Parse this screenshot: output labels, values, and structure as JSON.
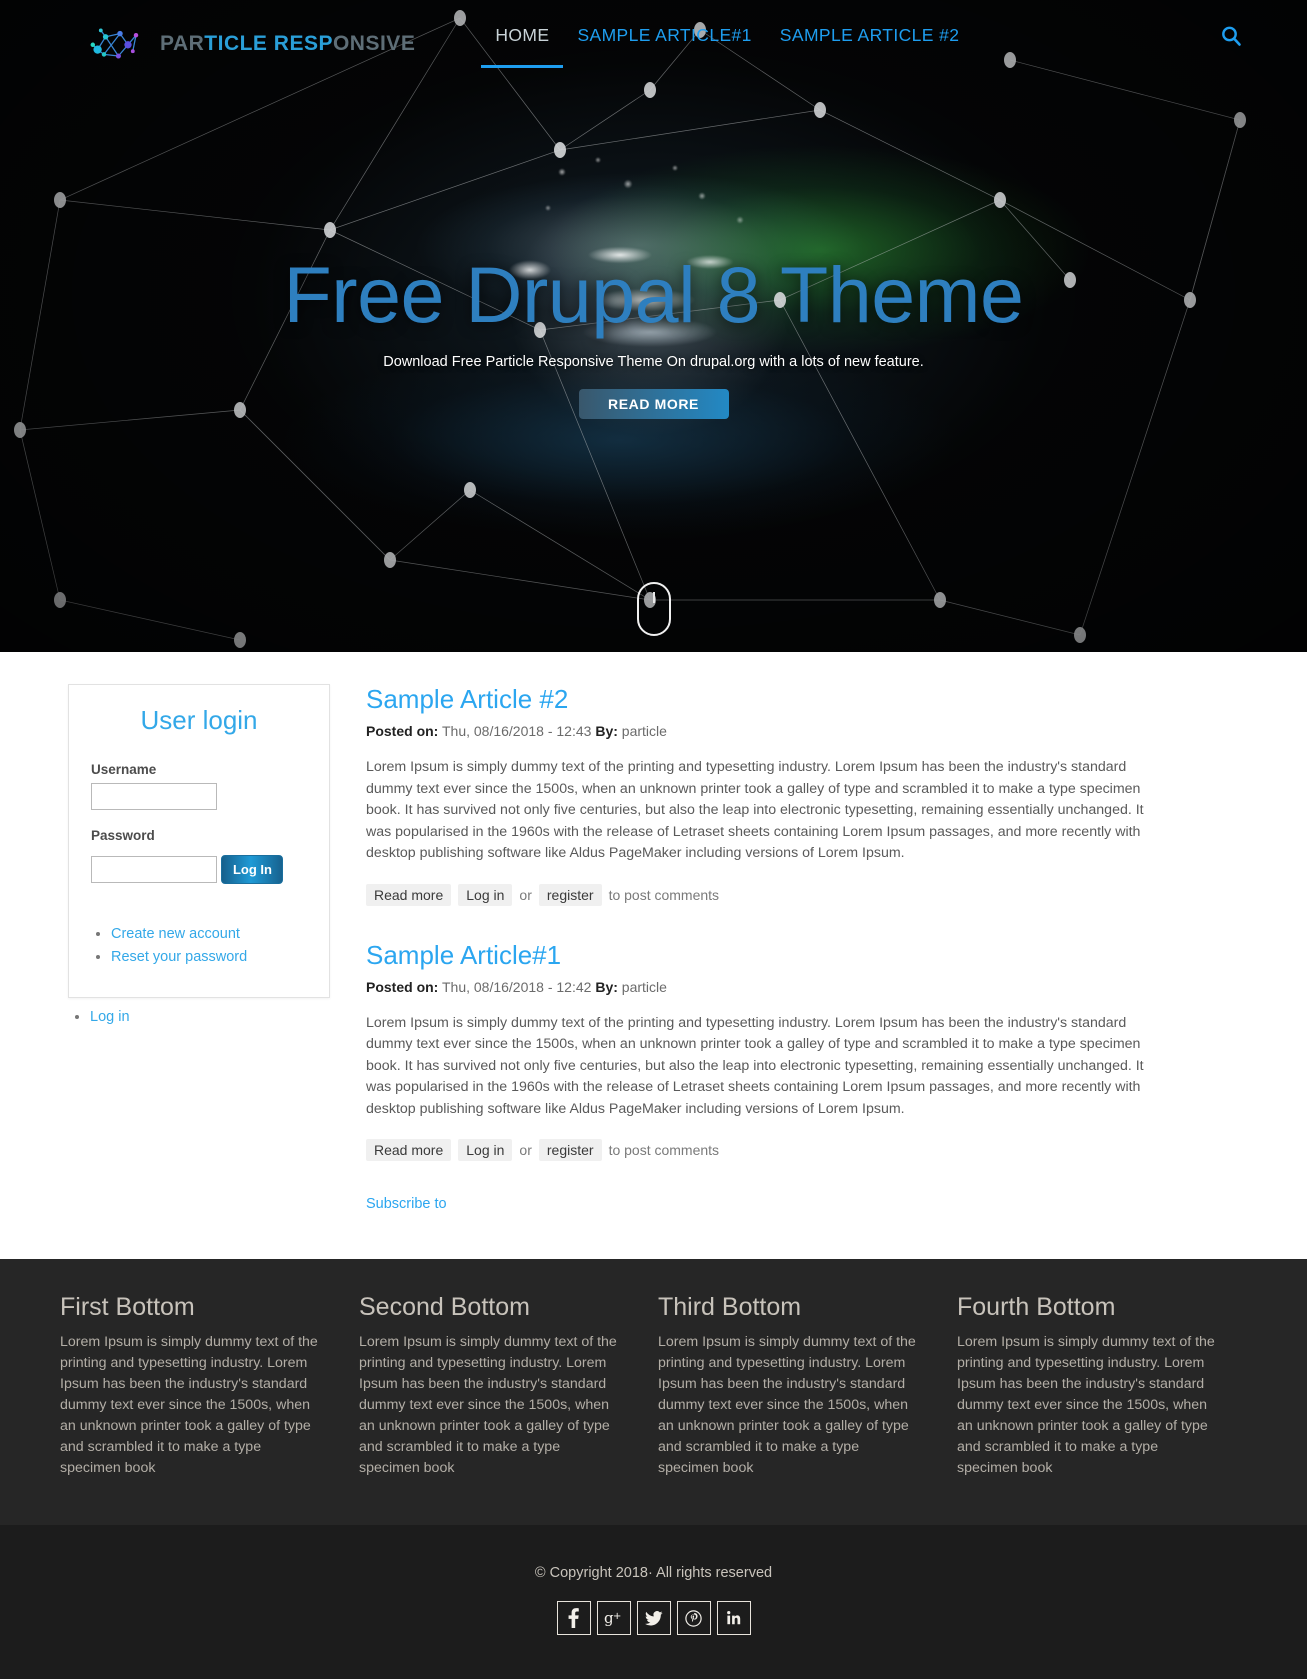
{
  "header": {
    "brand_dim_a": "PAR",
    "brand_lit": "TICLE RESP",
    "brand_dim_b": "ONSIVE",
    "brand_full": "PARTICLE RESPONSIVE",
    "nav": [
      {
        "label": "HOME",
        "active": true
      },
      {
        "label": "SAMPLE ARTICLE#1",
        "active": false
      },
      {
        "label": "SAMPLE ARTICLE #2",
        "active": false
      }
    ],
    "search_icon": "search-icon",
    "accent_color": "#1e9ef0"
  },
  "hero": {
    "title": "Free Drupal 8 Theme",
    "subtitle": "Download Free Particle Responsive Theme On drupal.org with a lots of new feature.",
    "cta_label": "READ MORE",
    "scroll_icon": "mouse-scroll-icon",
    "title_color": "#2e7fbf"
  },
  "sidebar": {
    "login": {
      "title": "User login",
      "username_label": "Username",
      "username_value": "",
      "password_label": "Password",
      "password_value": "",
      "submit_label": "Log In",
      "links": [
        "Create new account",
        "Reset your password"
      ]
    },
    "below_links": [
      "Log in"
    ]
  },
  "articles": [
    {
      "title": "Sample Article #2",
      "posted_label": "Posted on:",
      "posted_value": "Thu, 08/16/2018 - 12:43",
      "by_label": "By:",
      "by_value": "particle",
      "body": "Lorem Ipsum is simply dummy text of the printing and typesetting industry. Lorem Ipsum has been the industry's standard dummy text ever since the 1500s, when an unknown printer took a galley of type and scrambled it to make a type specimen book. It has survived not only five centuries, but also the leap into electronic typesetting, remaining essentially unchanged. It was popularised in the 1960s with the release of Letraset sheets containing Lorem Ipsum passages, and more recently with desktop publishing software like Aldus PageMaker including versions of Lorem Ipsum.",
      "read_more": "Read more",
      "login_link": "Log in",
      "or_text": "or",
      "register_link": "register",
      "post_comments_text": "to post comments"
    },
    {
      "title": "Sample Article#1",
      "posted_label": "Posted on:",
      "posted_value": "Thu, 08/16/2018 - 12:42",
      "by_label": "By:",
      "by_value": "particle",
      "body": "Lorem Ipsum is simply dummy text of the printing and typesetting industry. Lorem Ipsum has been the industry's standard dummy text ever since the 1500s, when an unknown printer took a galley of type and scrambled it to make a type specimen book. It has survived not only five centuries, but also the leap into electronic typesetting, remaining essentially unchanged. It was popularised in the 1960s with the release of Letraset sheets containing Lorem Ipsum passages, and more recently with desktop publishing software like Aldus PageMaker including versions of Lorem Ipsum.",
      "read_more": "Read more",
      "login_link": "Log in",
      "or_text": "or",
      "register_link": "register",
      "post_comments_text": "to post comments"
    }
  ],
  "subscribe_label": "Subscribe to",
  "footer": {
    "columns": [
      {
        "title": "First Bottom",
        "text": "Lorem Ipsum is simply dummy text of the printing and typesetting industry. Lorem Ipsum has been the industry's standard dummy text ever since the 1500s, when an unknown printer took a galley of type and scrambled it to make a type specimen book"
      },
      {
        "title": "Second Bottom",
        "text": "Lorem Ipsum is simply dummy text of the printing and typesetting industry. Lorem Ipsum has been the industry's standard dummy text ever since the 1500s, when an unknown printer took a galley of type and scrambled it to make a type specimen book"
      },
      {
        "title": "Third Bottom",
        "text": "Lorem Ipsum is simply dummy text of the printing and typesetting industry. Lorem Ipsum has been the industry's standard dummy text ever since the 1500s, when an unknown printer took a galley of type and scrambled it to make a type specimen book"
      },
      {
        "title": "Fourth Bottom",
        "text": "Lorem Ipsum is simply dummy text of the printing and typesetting industry. Lorem Ipsum has been the industry's standard dummy text ever since the 1500s, when an unknown printer took a galley of type and scrambled it to make a type specimen book"
      }
    ],
    "copyright": "© Copyright 2018· All rights reserved",
    "socials": [
      {
        "name": "facebook-icon",
        "glyph": "f"
      },
      {
        "name": "google-plus-icon",
        "glyph": "g+"
      },
      {
        "name": "twitter-icon",
        "glyph": "🐦"
      },
      {
        "name": "pinterest-icon",
        "glyph": "℗"
      },
      {
        "name": "linkedin-icon",
        "glyph": "in"
      }
    ]
  }
}
